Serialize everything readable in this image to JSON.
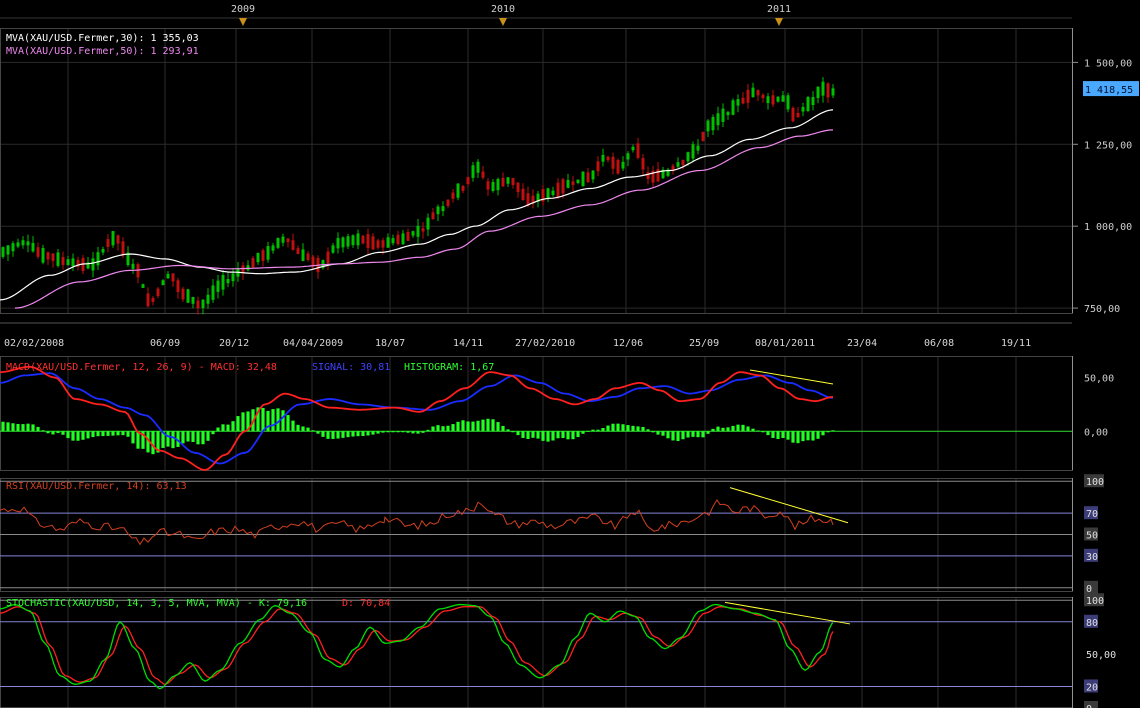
{
  "chart_data": [
    {
      "type": "line",
      "panel": "price",
      "legend": [
        {
          "label": "MVA(XAU/USD.Fermer,30): 1 355,03",
          "color": "#ffffff"
        },
        {
          "label": "MVA(XAU/USD.Fermer,50): 1 293,91",
          "color": "#ee88ee"
        }
      ],
      "last_price_label": "1 418,55",
      "y_ticks": [
        "1 500,00",
        "1 250,00",
        "1 000,00",
        "750,00"
      ],
      "y_tick_values": [
        1500,
        1250,
        1000,
        750
      ],
      "ylim": [
        735,
        1605
      ],
      "x_tick_labels": [
        "02/02/2008",
        "06/09",
        "20/12",
        "04/04/2009",
        "18/07",
        "14/11",
        "27/02/2010",
        "12/06",
        "25/09",
        "08/01/2011",
        "23/04",
        "06/08",
        "19/11"
      ],
      "year_markers": [
        "2009",
        "2010",
        "2011"
      ],
      "ma30_anchors": [
        [
          0,
          775
        ],
        [
          50,
          850
        ],
        [
          85,
          885
        ],
        [
          130,
          915
        ],
        [
          165,
          900
        ],
        [
          200,
          875
        ],
        [
          230,
          860
        ],
        [
          260,
          855
        ],
        [
          295,
          860
        ],
        [
          340,
          885
        ],
        [
          380,
          920
        ],
        [
          420,
          945
        ],
        [
          450,
          975
        ],
        [
          475,
          1000
        ],
        [
          510,
          1050
        ],
        [
          550,
          1085
        ],
        [
          590,
          1115
        ],
        [
          630,
          1150
        ],
        [
          670,
          1170
        ],
        [
          710,
          1215
        ],
        [
          750,
          1265
        ],
        [
          790,
          1300
        ],
        [
          833,
          1355
        ]
      ],
      "ma50_anchors": [
        [
          15,
          750
        ],
        [
          80,
          830
        ],
        [
          130,
          865
        ],
        [
          180,
          880
        ],
        [
          230,
          870
        ],
        [
          290,
          875
        ],
        [
          340,
          885
        ],
        [
          380,
          890
        ],
        [
          420,
          905
        ],
        [
          455,
          930
        ],
        [
          490,
          985
        ],
        [
          540,
          1030
        ],
        [
          590,
          1065
        ],
        [
          640,
          1110
        ],
        [
          700,
          1170
        ],
        [
          760,
          1240
        ],
        [
          800,
          1275
        ],
        [
          833,
          1294
        ]
      ],
      "candle_anchors": [
        [
          0,
          920
        ],
        [
          25,
          950
        ],
        [
          45,
          910
        ],
        [
          70,
          890
        ],
        [
          90,
          880
        ],
        [
          115,
          965
        ],
        [
          135,
          875
        ],
        [
          150,
          770
        ],
        [
          170,
          850
        ],
        [
          185,
          790
        ],
        [
          200,
          760
        ],
        [
          225,
          830
        ],
        [
          245,
          870
        ],
        [
          262,
          910
        ],
        [
          285,
          960
        ],
        [
          305,
          910
        ],
        [
          320,
          880
        ],
        [
          340,
          950
        ],
        [
          360,
          960
        ],
        [
          380,
          945
        ],
        [
          400,
          960
        ],
        [
          420,
          985
        ],
        [
          440,
          1050
        ],
        [
          460,
          1110
        ],
        [
          478,
          1180
        ],
        [
          490,
          1120
        ],
        [
          510,
          1140
        ],
        [
          530,
          1080
        ],
        [
          550,
          1100
        ],
        [
          570,
          1130
        ],
        [
          590,
          1150
        ],
        [
          605,
          1210
        ],
        [
          620,
          1180
        ],
        [
          635,
          1240
        ],
        [
          650,
          1150
        ],
        [
          665,
          1160
        ],
        [
          680,
          1190
        ],
        [
          695,
          1230
        ],
        [
          710,
          1310
        ],
        [
          725,
          1340
        ],
        [
          740,
          1380
        ],
        [
          755,
          1410
        ],
        [
          770,
          1385
        ],
        [
          785,
          1390
        ],
        [
          795,
          1335
        ],
        [
          810,
          1375
        ],
        [
          822,
          1420
        ],
        [
          833,
          1410
        ]
      ]
    },
    {
      "type": "line",
      "panel": "macd",
      "title": "MACD(XAU/USD.Fermer, 12, 26, 9)  -  MACD: 32,48",
      "signal_label": "SIGNAL: 30,81",
      "histogram_label": "HISTOGRAM: 1,67",
      "y_ticks": [
        "50,00",
        "0,00"
      ],
      "y_tick_values": [
        50,
        0
      ],
      "ylim": [
        -36,
        70
      ],
      "macd_anchors": [
        [
          0,
          55
        ],
        [
          30,
          60
        ],
        [
          55,
          50
        ],
        [
          75,
          30
        ],
        [
          100,
          25
        ],
        [
          125,
          18
        ],
        [
          140,
          -2
        ],
        [
          160,
          -18
        ],
        [
          180,
          -25
        ],
        [
          205,
          -36
        ],
        [
          225,
          -22
        ],
        [
          245,
          0
        ],
        [
          265,
          25
        ],
        [
          285,
          35
        ],
        [
          305,
          30
        ],
        [
          330,
          22
        ],
        [
          360,
          20
        ],
        [
          395,
          22
        ],
        [
          420,
          18
        ],
        [
          440,
          28
        ],
        [
          465,
          40
        ],
        [
          490,
          55
        ],
        [
          510,
          52
        ],
        [
          530,
          40
        ],
        [
          555,
          30
        ],
        [
          575,
          25
        ],
        [
          595,
          30
        ],
        [
          615,
          40
        ],
        [
          640,
          45
        ],
        [
          660,
          38
        ],
        [
          680,
          28
        ],
        [
          700,
          30
        ],
        [
          720,
          45
        ],
        [
          740,
          55
        ],
        [
          760,
          52
        ],
        [
          780,
          40
        ],
        [
          800,
          30
        ],
        [
          815,
          28
        ],
        [
          833,
          32
        ]
      ],
      "signal_anchors": [
        [
          0,
          45
        ],
        [
          25,
          52
        ],
        [
          50,
          54
        ],
        [
          75,
          40
        ],
        [
          100,
          30
        ],
        [
          125,
          22
        ],
        [
          145,
          15
        ],
        [
          170,
          -5
        ],
        [
          195,
          -20
        ],
        [
          220,
          -30
        ],
        [
          245,
          -20
        ],
        [
          270,
          5
        ],
        [
          300,
          25
        ],
        [
          330,
          30
        ],
        [
          360,
          25
        ],
        [
          395,
          22
        ],
        [
          430,
          20
        ],
        [
          460,
          28
        ],
        [
          490,
          42
        ],
        [
          515,
          52
        ],
        [
          540,
          45
        ],
        [
          565,
          35
        ],
        [
          590,
          28
        ],
        [
          615,
          32
        ],
        [
          640,
          40
        ],
        [
          665,
          42
        ],
        [
          690,
          35
        ],
        [
          710,
          38
        ],
        [
          740,
          48
        ],
        [
          765,
          52
        ],
        [
          790,
          45
        ],
        [
          810,
          38
        ],
        [
          833,
          31
        ]
      ],
      "trend_line": [
        [
          750,
          57
        ],
        [
          833,
          44
        ]
      ]
    },
    {
      "type": "line",
      "panel": "rsi",
      "title": "RSI(XAU/USD.Fermer, 14): 63,13",
      "y_ticks": [
        "100",
        "70",
        "50",
        "30",
        "0"
      ],
      "y_tick_values": [
        100,
        70,
        50,
        30,
        0
      ],
      "ylim": [
        -3,
        103
      ],
      "rsi_anchors": [
        [
          0,
          73
        ],
        [
          20,
          75
        ],
        [
          40,
          60
        ],
        [
          60,
          55
        ],
        [
          80,
          62
        ],
        [
          100,
          58
        ],
        [
          120,
          55
        ],
        [
          140,
          42
        ],
        [
          160,
          52
        ],
        [
          180,
          50
        ],
        [
          195,
          44
        ],
        [
          215,
          53
        ],
        [
          235,
          55
        ],
        [
          255,
          50
        ],
        [
          275,
          58
        ],
        [
          300,
          62
        ],
        [
          320,
          55
        ],
        [
          340,
          60
        ],
        [
          360,
          55
        ],
        [
          385,
          65
        ],
        [
          410,
          58
        ],
        [
          430,
          60
        ],
        [
          450,
          70
        ],
        [
          470,
          72
        ],
        [
          480,
          82
        ],
        [
          495,
          68
        ],
        [
          515,
          60
        ],
        [
          535,
          62
        ],
        [
          555,
          58
        ],
        [
          575,
          62
        ],
        [
          595,
          66
        ],
        [
          615,
          58
        ],
        [
          635,
          72
        ],
        [
          650,
          55
        ],
        [
          665,
          58
        ],
        [
          685,
          62
        ],
        [
          705,
          70
        ],
        [
          720,
          80
        ],
        [
          735,
          72
        ],
        [
          750,
          75
        ],
        [
          765,
          68
        ],
        [
          780,
          72
        ],
        [
          795,
          58
        ],
        [
          815,
          65
        ],
        [
          833,
          63
        ]
      ],
      "trend_line": [
        [
          730,
          94
        ],
        [
          848,
          61
        ]
      ]
    },
    {
      "type": "line",
      "panel": "stochastic",
      "title": "STOCHASTIC(XAU/USD, 14, 3, 5, MVA, MVA)  -  K: 79,16",
      "d_label": "D: 70,84",
      "y_ticks": [
        "100",
        "80",
        "50,00",
        "20",
        "0"
      ],
      "y_tick_values": [
        100,
        80,
        50,
        20,
        0
      ],
      "ylim": [
        0,
        103
      ],
      "k_anchors": [
        [
          0,
          92
        ],
        [
          15,
          96
        ],
        [
          30,
          90
        ],
        [
          45,
          60
        ],
        [
          60,
          30
        ],
        [
          75,
          22
        ],
        [
          90,
          25
        ],
        [
          105,
          45
        ],
        [
          120,
          80
        ],
        [
          135,
          55
        ],
        [
          150,
          25
        ],
        [
          160,
          18
        ],
        [
          175,
          30
        ],
        [
          190,
          42
        ],
        [
          205,
          25
        ],
        [
          220,
          35
        ],
        [
          240,
          60
        ],
        [
          260,
          82
        ],
        [
          275,
          95
        ],
        [
          290,
          88
        ],
        [
          310,
          70
        ],
        [
          325,
          45
        ],
        [
          340,
          38
        ],
        [
          355,
          55
        ],
        [
          370,
          75
        ],
        [
          385,
          60
        ],
        [
          400,
          62
        ],
        [
          420,
          75
        ],
        [
          440,
          92
        ],
        [
          460,
          96
        ],
        [
          475,
          95
        ],
        [
          490,
          85
        ],
        [
          505,
          60
        ],
        [
          520,
          40
        ],
        [
          540,
          28
        ],
        [
          560,
          40
        ],
        [
          575,
          65
        ],
        [
          590,
          88
        ],
        [
          605,
          80
        ],
        [
          620,
          90
        ],
        [
          635,
          85
        ],
        [
          650,
          65
        ],
        [
          665,
          55
        ],
        [
          680,
          65
        ],
        [
          700,
          90
        ],
        [
          715,
          96
        ],
        [
          735,
          92
        ],
        [
          755,
          88
        ],
        [
          775,
          82
        ],
        [
          790,
          55
        ],
        [
          805,
          35
        ],
        [
          820,
          52
        ],
        [
          833,
          79
        ]
      ],
      "d_anchors": [
        [
          0,
          88
        ],
        [
          18,
          94
        ],
        [
          35,
          88
        ],
        [
          50,
          58
        ],
        [
          65,
          30
        ],
        [
          80,
          24
        ],
        [
          95,
          28
        ],
        [
          110,
          48
        ],
        [
          125,
          76
        ],
        [
          140,
          55
        ],
        [
          155,
          28
        ],
        [
          165,
          22
        ],
        [
          180,
          32
        ],
        [
          195,
          40
        ],
        [
          210,
          28
        ],
        [
          225,
          36
        ],
        [
          245,
          60
        ],
        [
          265,
          80
        ],
        [
          280,
          92
        ],
        [
          295,
          88
        ],
        [
          315,
          68
        ],
        [
          330,
          46
        ],
        [
          345,
          40
        ],
        [
          360,
          55
        ],
        [
          375,
          72
        ],
        [
          390,
          62
        ],
        [
          405,
          63
        ],
        [
          425,
          75
        ],
        [
          445,
          90
        ],
        [
          465,
          94
        ],
        [
          480,
          94
        ],
        [
          495,
          84
        ],
        [
          510,
          62
        ],
        [
          525,
          42
        ],
        [
          545,
          30
        ],
        [
          565,
          42
        ],
        [
          580,
          64
        ],
        [
          595,
          85
        ],
        [
          610,
          82
        ],
        [
          625,
          88
        ],
        [
          640,
          84
        ],
        [
          655,
          66
        ],
        [
          670,
          57
        ],
        [
          685,
          66
        ],
        [
          705,
          88
        ],
        [
          720,
          94
        ],
        [
          740,
          92
        ],
        [
          760,
          86
        ],
        [
          780,
          80
        ],
        [
          795,
          57
        ],
        [
          810,
          38
        ],
        [
          825,
          50
        ],
        [
          833,
          71
        ]
      ],
      "trend_line": [
        [
          725,
          98
        ],
        [
          850,
          78
        ]
      ]
    }
  ],
  "colors": {
    "background": "#000000",
    "grid": "#2b2b2b",
    "frame": "#909090",
    "up_candle": "#00c000",
    "down_candle": "#c01010",
    "ma30": "#ffffff",
    "ma50": "#ee88ee",
    "macd": "#ff2020",
    "signal": "#1a2cff",
    "histogram": "#22ff22",
    "rsi": "#d04020",
    "stoch_k": "#00dd00",
    "stoch_d": "#ff2020",
    "trend": "#ffff33",
    "price_label_bg": "#4aa8ff",
    "year_marker": "#c8901a",
    "title_green": "#30ff30",
    "title_red": "#ff3030",
    "title_blue": "#4040ff"
  }
}
